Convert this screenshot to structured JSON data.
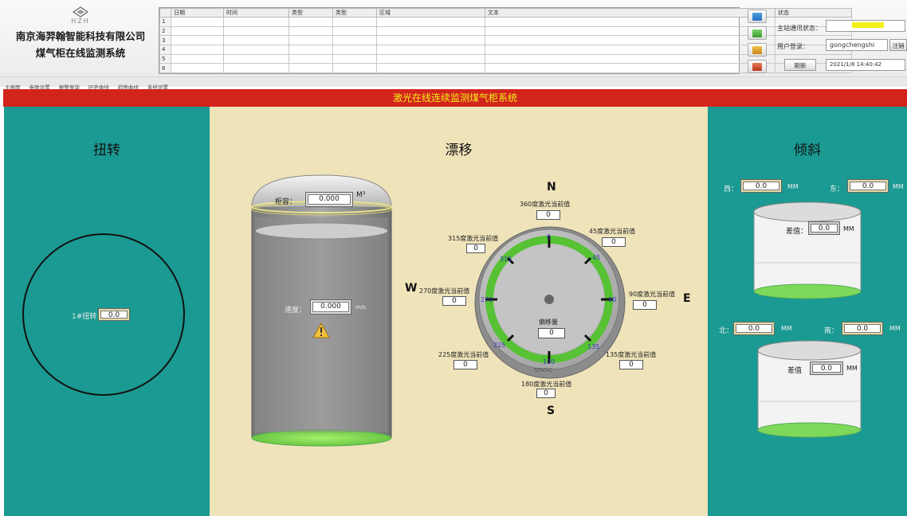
{
  "header": {
    "logo_sub": "HZH",
    "company": "南京海羿翰智能科技有限公司",
    "system": "煤气柜在线监测系统"
  },
  "log_table": {
    "columns": [
      "日期",
      "时间",
      "类型",
      "类型",
      "区域",
      "文本",
      "状态"
    ],
    "row_numbers": [
      "1",
      "2",
      "3",
      "4",
      "5",
      "6"
    ]
  },
  "toolbar_icons": [
    "table-icon",
    "refresh-icon",
    "print-icon",
    "export-icon"
  ],
  "status": {
    "comm_label": "主站通讯状态：",
    "comm_value": "",
    "login_label": "用户登录：",
    "login_user": "gongchengshi",
    "logout_label": "注销",
    "refresh_label": "刷新",
    "datetime": "2021/1/8 14:40:42",
    "accent": "#f4f01a"
  },
  "menu": [
    "主画面",
    "参数设置",
    "报警查询",
    "历史曲线",
    "趋势曲线",
    "系统设置"
  ],
  "banner": "激光在线连续监测煤气柜系统",
  "left": {
    "title": "扭转",
    "twist_label": "1#扭转：",
    "twist_value": "0.0"
  },
  "middle": {
    "title": "漂移",
    "tank": {
      "height_label": "柜容：",
      "height_value": "0.000",
      "height_unit": "M³",
      "speed_label": "速度：",
      "speed_value": "0.000",
      "speed_unit": "m/s"
    },
    "compass": {
      "n": "N",
      "s": "S",
      "e": "E",
      "w": "W",
      "l360": "360度激光当前值",
      "v360": "0",
      "l45": "45度激光当前值",
      "v45": "0",
      "l90": "90度激光当前值",
      "v90": "0",
      "l135": "135度激光当前值",
      "v135": "0",
      "l180": "180度激光当前值",
      "v180": "0",
      "l225": "225度激光当前值",
      "v225": "0",
      "l270": "270度激光当前值",
      "v270": "0",
      "l315": "315度激光当前值",
      "v315": "0",
      "offset_label": "偏移量",
      "offset_value": "0",
      "deg": [
        "0",
        "45",
        "90",
        "135",
        "180",
        "225",
        "270",
        "315"
      ],
      "dial_text": "STATIC"
    }
  },
  "right": {
    "title": "倾斜",
    "west_label": "西：",
    "west_value": "0.0",
    "west_unit": "MM",
    "east_label": "东：",
    "east_value": "0.0",
    "east_unit": "MM",
    "diff1_label": "差值：",
    "diff1_value": "0.0",
    "diff1_unit": "MM",
    "north_label": "北：",
    "north_value": "0.0",
    "north_unit": "MM",
    "south_label": "南：",
    "south_value": "0.0",
    "south_unit": "MM",
    "diff2_label": "差值",
    "diff2_value": "0.0",
    "diff2_unit": "MM"
  }
}
